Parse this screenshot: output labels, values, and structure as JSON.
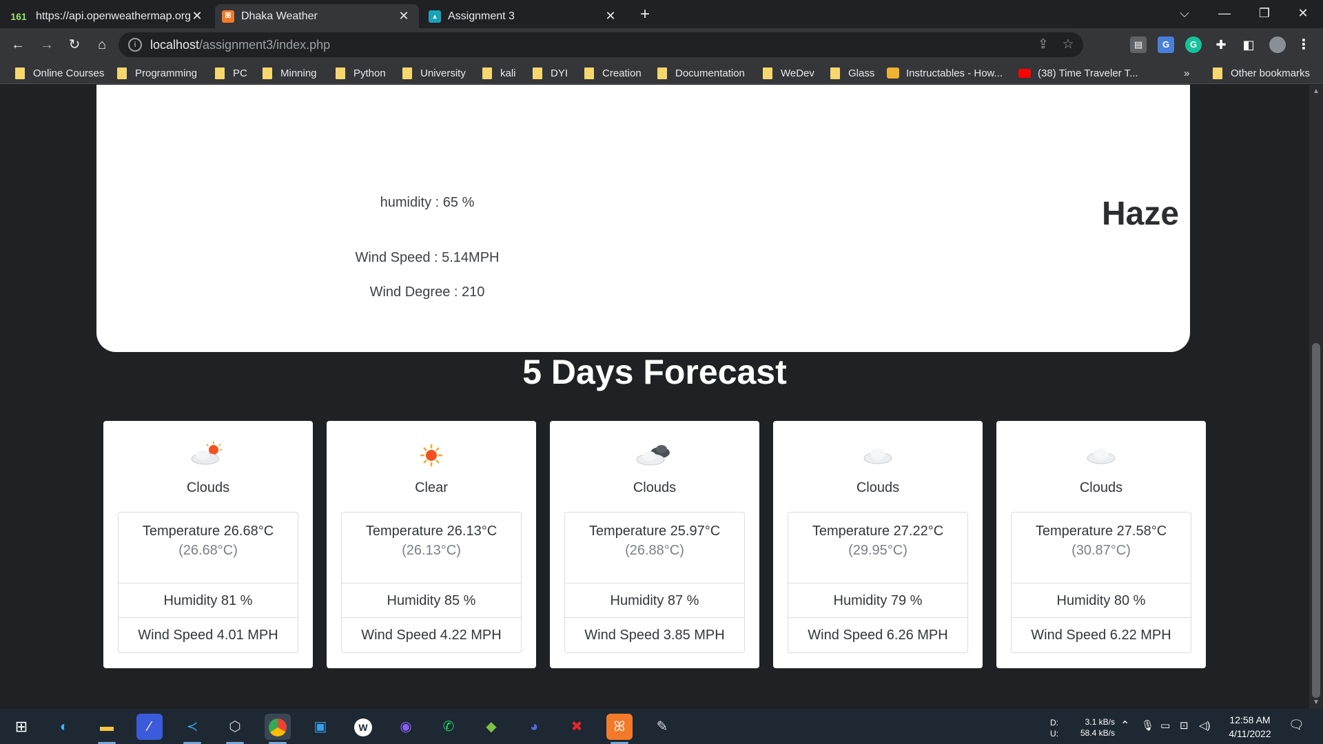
{
  "browser": {
    "tabs": [
      {
        "title": "https://api.openweathermap.org/",
        "favicon": "counter-badge-icon",
        "badge": "161"
      },
      {
        "title": "Dhaka Weather",
        "favicon": "xampp-icon",
        "active": true
      },
      {
        "title": "Assignment 3",
        "favicon": "classroom-icon"
      }
    ],
    "url_host": "localhost",
    "url_path": "/assignment3/index.php",
    "bookmarks": [
      "Online Courses",
      "Programming",
      "PC",
      "Minning",
      "Python",
      "University",
      "kali",
      "DYI",
      "Creation",
      "Documentation",
      "WeDev",
      "Glass",
      "Instructables - How...",
      "(38) Time Traveler T..."
    ],
    "bookmarks_more": "»",
    "other_bookmarks": "Other bookmarks"
  },
  "current": {
    "humidity": "humidity : 65 %",
    "wind_speed": "Wind Speed : 5.14MPH",
    "wind_degree": "Wind Degree : 210",
    "condition": "Haze"
  },
  "forecast": {
    "title": "5 Days Forecast",
    "days": [
      {
        "condition": "Clouds",
        "icon": "sun-behind-cloud-icon",
        "temp": "Temperature 26.68°C",
        "feels": "(26.68°C)",
        "humidity": "Humidity 81 %",
        "wind": "Wind Speed 4.01 MPH"
      },
      {
        "condition": "Clear",
        "icon": "sun-icon",
        "temp": "Temperature 26.13°C",
        "feels": "(26.13°C)",
        "humidity": "Humidity 85 %",
        "wind": "Wind Speed 4.22 MPH"
      },
      {
        "condition": "Clouds",
        "icon": "broken-clouds-icon",
        "temp": "Temperature 25.97°C",
        "feels": "(26.88°C)",
        "humidity": "Humidity 87 %",
        "wind": "Wind Speed 3.85 MPH"
      },
      {
        "condition": "Clouds",
        "icon": "cloud-icon",
        "temp": "Temperature 27.22°C",
        "feels": "(29.95°C)",
        "humidity": "Humidity 79 %",
        "wind": "Wind Speed 6.26 MPH"
      },
      {
        "condition": "Clouds",
        "icon": "cloud-icon",
        "temp": "Temperature 27.58°C",
        "feels": "(30.87°C)",
        "humidity": "Humidity 80 %",
        "wind": "Wind Speed 6.22 MPH"
      }
    ]
  },
  "taskbar": {
    "net_labels": "D:\nU:",
    "down": "3.1 kB/s",
    "up": "58.4 kB/s",
    "time": "12:58 AM",
    "date": "4/11/2022"
  },
  "colors": {
    "page_bg": "#202124",
    "card_bg": "#ffffff",
    "taskbar_bg": "#1d2833"
  }
}
